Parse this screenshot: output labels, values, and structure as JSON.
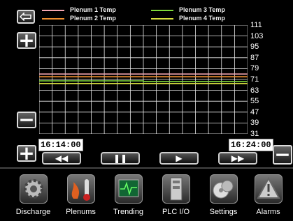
{
  "legend": [
    {
      "name": "Plenum 1 Temp",
      "color": "#f4a6b0"
    },
    {
      "name": "Plenum 2 Temp",
      "color": "#f09030"
    },
    {
      "name": "Plenum 3 Temp",
      "color": "#7fd83a"
    },
    {
      "name": "Plenum 4 Temp",
      "color": "#d8e040"
    }
  ],
  "buttons": {
    "back_icon": "back-arrow-icon",
    "zoom_in_top": "+",
    "zoom_out_left": "−",
    "zoom_in_bottom": "+",
    "zoom_out_right": "−"
  },
  "chart_data": {
    "type": "line",
    "x_start": "16:14:00",
    "x_end": "16:24:00",
    "ylim": [
      31,
      111
    ],
    "y_ticks": [
      111,
      103,
      95,
      87,
      79,
      71,
      63,
      55,
      47,
      39,
      31
    ],
    "grid": true,
    "series": [
      {
        "name": "Plenum 1 Temp",
        "color": "#f4a6b0",
        "x": [
          "16:14:00",
          "16:24:00"
        ],
        "values": [
          75,
          75
        ]
      },
      {
        "name": "Plenum 2 Temp",
        "color": "#f09030",
        "x": [
          "16:14:00",
          "16:24:00"
        ],
        "values": [
          73,
          73
        ]
      },
      {
        "name": "Plenum 3 Temp",
        "color": "#7fd83a",
        "x": [
          "16:14:00",
          "16:19:00",
          "16:19:00",
          "16:24:00"
        ],
        "values": [
          70,
          70,
          69.5,
          69.5
        ]
      },
      {
        "name": "Plenum 4 Temp",
        "color": "#d8e040",
        "x": [
          "16:14:00",
          "16:24:00"
        ],
        "values": [
          68,
          68
        ]
      }
    ]
  },
  "time": {
    "start": "16:14:00",
    "end": "16:24:00"
  },
  "transport": [
    {
      "name": "rewind-button",
      "icon": "rewind-icon",
      "glyph": "◀◀"
    },
    {
      "name": "pause-button",
      "icon": "pause-icon",
      "glyph": "❚❚"
    },
    {
      "name": "play-button",
      "icon": "play-icon",
      "glyph": "▶"
    },
    {
      "name": "fast-forward-button",
      "icon": "fast-forward-icon",
      "glyph": "▶▶"
    }
  ],
  "nav": [
    {
      "label": "Discharge",
      "icon": "gear-icon"
    },
    {
      "label": "Plenums",
      "icon": "thermometer-flame-icon"
    },
    {
      "label": "Trending",
      "icon": "trend-monitor-icon"
    },
    {
      "label": "PLC I/O",
      "icon": "plc-module-icon"
    },
    {
      "label": "Settings",
      "icon": "settings-disc-icon"
    },
    {
      "label": "Alarms",
      "icon": "warning-icon"
    }
  ]
}
